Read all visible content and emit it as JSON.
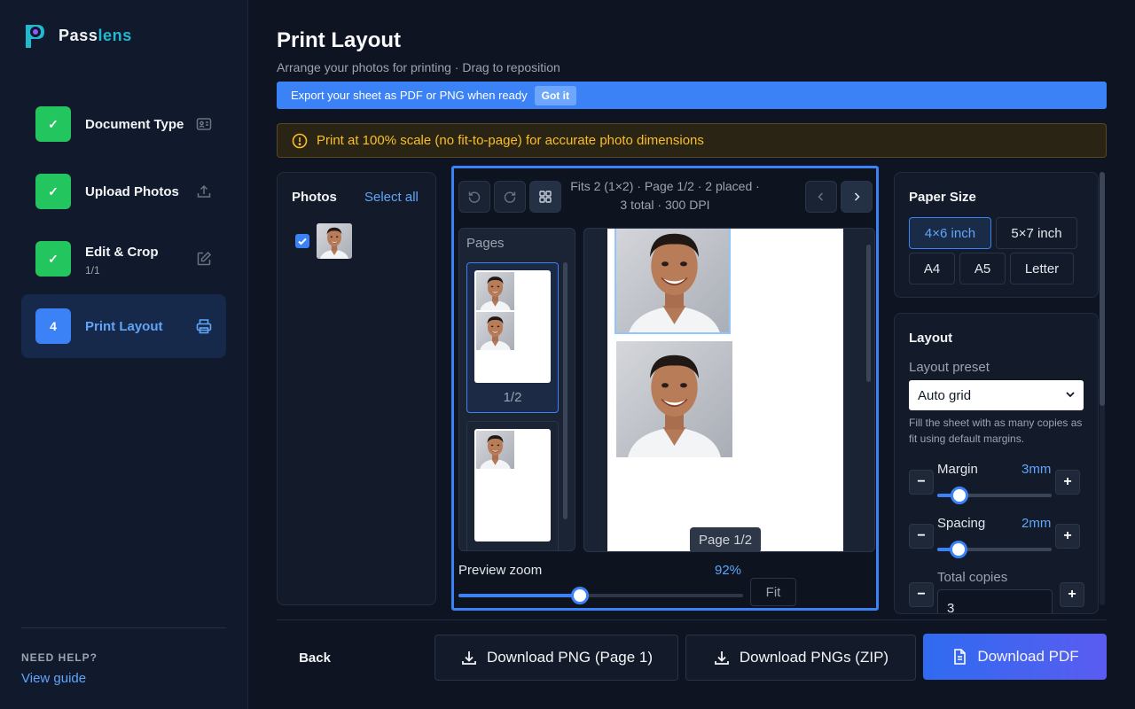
{
  "app": {
    "name_part1": "Pass",
    "name_part2": "lens"
  },
  "steps": [
    {
      "label": "Document Type",
      "badge": "✓",
      "sub": "",
      "icon": "id-card-icon"
    },
    {
      "label": "Upload Photos",
      "badge": "✓",
      "sub": "",
      "icon": "upload-icon"
    },
    {
      "label": "Edit & Crop",
      "badge": "✓",
      "sub": "1/1",
      "icon": "edit-icon"
    },
    {
      "label": "Print Layout",
      "badge": "4",
      "sub": "",
      "icon": "printer-icon"
    }
  ],
  "help": {
    "title": "NEED HELP?",
    "link": "View guide"
  },
  "header": {
    "title": "Print Layout",
    "subtitle": "Arrange your photos for printing · Drag to reposition",
    "banner_text": "Export your sheet as PDF or PNG when ready",
    "banner_button": "Got it",
    "warning": "Print at 100% scale (no fit-to-page) for accurate photo dimensions"
  },
  "photos_panel": {
    "title": "Photos",
    "select_all": "Select all"
  },
  "preview": {
    "info": "Fits 2 (1×2) · Page 1/2 · 2 placed · 3 total · 300 DPI",
    "pages_title": "Pages",
    "page1_label": "1/2",
    "page_pill": "Page 1/2",
    "zoom_label": "Preview zoom",
    "zoom_value": "92%",
    "zoom_fraction": 0.42,
    "fit_button": "Fit"
  },
  "paper": {
    "title": "Paper Size",
    "options": [
      "4×6 inch",
      "5×7 inch",
      "A4",
      "A5",
      "Letter"
    ],
    "selected": "4×6 inch"
  },
  "layout": {
    "title": "Layout",
    "preset_label": "Layout preset",
    "preset_value": "Auto grid",
    "preset_hint": "Fill the sheet with as many copies as fit using default margins.",
    "margin_label": "Margin",
    "margin_value": "3mm",
    "spacing_label": "Spacing",
    "spacing_value": "2mm",
    "copies_label": "Total copies",
    "copies_value": "3"
  },
  "footer": {
    "back": "Back",
    "download_png": "Download PNG (Page 1)",
    "download_zip": "Download PNGs (ZIP)",
    "download_pdf": "Download PDF"
  },
  "colors": {
    "accent": "#3b82f6",
    "success": "#22c55e",
    "warning": "#fbbf24",
    "brand": "#22b8cf"
  }
}
